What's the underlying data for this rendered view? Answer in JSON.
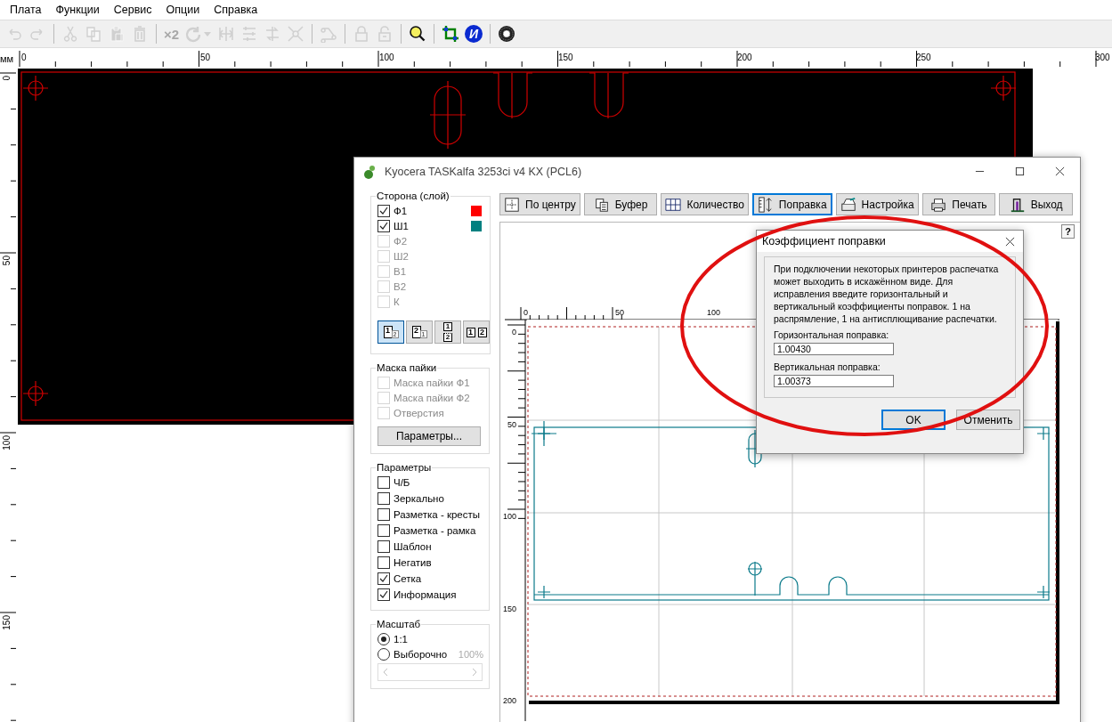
{
  "menu": [
    {
      "label": "Плата"
    },
    {
      "label": "Функции"
    },
    {
      "label": "Сервис"
    },
    {
      "label": "Опции"
    },
    {
      "label": "Справка"
    }
  ],
  "toolbar": [
    {
      "kind": "undo",
      "disabled": true
    },
    {
      "kind": "redo",
      "disabled": true
    },
    {
      "kind": "separator"
    },
    {
      "kind": "cut",
      "disabled": true
    },
    {
      "kind": "copy",
      "disabled": true
    },
    {
      "kind": "paste",
      "disabled": true
    },
    {
      "kind": "delete",
      "disabled": true
    },
    {
      "kind": "separator"
    },
    {
      "kind": "text",
      "label": "×2",
      "disabled": true
    },
    {
      "kind": "rotate",
      "disabled": true
    },
    {
      "kind": "caret",
      "disabled": true
    },
    {
      "kind": "mirror",
      "disabled": true
    },
    {
      "kind": "align",
      "disabled": true
    },
    {
      "kind": "flip",
      "disabled": true
    },
    {
      "kind": "shrink",
      "disabled": true
    },
    {
      "kind": "separator"
    },
    {
      "kind": "route",
      "disabled": true
    },
    {
      "kind": "separator"
    },
    {
      "kind": "lock",
      "disabled": true
    },
    {
      "kind": "unlock",
      "disabled": true
    },
    {
      "kind": "separator"
    },
    {
      "kind": "magnifier",
      "disabled": false
    },
    {
      "kind": "separator"
    },
    {
      "kind": "crop",
      "disabled": false
    },
    {
      "kind": "info",
      "label": "И",
      "disabled": false
    },
    {
      "kind": "separator"
    },
    {
      "kind": "pattern",
      "disabled": false
    }
  ],
  "ruler": {
    "unit": "мм",
    "x_labels": [
      "0",
      "50",
      "100",
      "150",
      "200",
      "250",
      "300"
    ],
    "y_labels": [
      "0",
      "50",
      "100",
      "150"
    ]
  },
  "print_window": {
    "title": "Kyocera TASKalfa 3253ci v4 KX (PCL6)",
    "side_group": {
      "title": "Сторона (слой)",
      "layers": [
        {
          "label": "Ф1",
          "checked": true,
          "disabled": false,
          "color": "#ff0000"
        },
        {
          "label": "Ш1",
          "checked": true,
          "disabled": false,
          "color": "#008080"
        },
        {
          "label": "Ф2",
          "checked": false,
          "disabled": true
        },
        {
          "label": "Ш2",
          "checked": false,
          "disabled": true
        },
        {
          "label": "В1",
          "checked": false,
          "disabled": true
        },
        {
          "label": "В2",
          "checked": false,
          "disabled": true
        },
        {
          "label": "К",
          "checked": false,
          "disabled": true
        }
      ],
      "layout_buttons": [
        {
          "kind": "overlap",
          "front": "1",
          "back": "2",
          "selected": true
        },
        {
          "kind": "overlap",
          "front": "2",
          "back": "1",
          "selected": false
        },
        {
          "kind": "stacked",
          "front": "1",
          "back": "2",
          "selected": false
        },
        {
          "kind": "side",
          "front": "1",
          "back": "2",
          "selected": false
        }
      ]
    },
    "mask_group": {
      "title": "Маска пайки",
      "items": [
        {
          "label": "Маска пайки Ф1",
          "checked": false,
          "disabled": true
        },
        {
          "label": "Маска пайки Ф2",
          "checked": false,
          "disabled": true
        },
        {
          "label": "Отверстия",
          "checked": false,
          "disabled": true
        }
      ],
      "button": "Параметры..."
    },
    "params_group": {
      "title": "Параметры",
      "items": [
        {
          "label": "Ч/Б",
          "checked": false,
          "disabled": false
        },
        {
          "label": "Зеркально",
          "checked": false,
          "disabled": false
        },
        {
          "label": "Разметка - кресты",
          "checked": false,
          "disabled": false
        },
        {
          "label": "Разметка - рамка",
          "checked": false,
          "disabled": false
        },
        {
          "label": "Шаблон",
          "checked": false,
          "disabled": false
        },
        {
          "label": "Негатив",
          "checked": false,
          "disabled": false
        },
        {
          "label": "Сетка",
          "checked": true,
          "disabled": false
        },
        {
          "label": "Информация",
          "checked": true,
          "disabled": false
        }
      ]
    },
    "scale_group": {
      "title": "Масштаб",
      "options": [
        {
          "label": "1:1",
          "selected": true
        },
        {
          "label": "Выборочно",
          "selected": false
        }
      ],
      "percent": "100%",
      "slider_disabled": true
    },
    "buttons": [
      {
        "kind": "center",
        "label": "По центру",
        "selected": false
      },
      {
        "kind": "clipboard",
        "label": "Буфер",
        "selected": false
      },
      {
        "kind": "count",
        "label": "Количество",
        "selected": false
      },
      {
        "kind": "correction",
        "label": "Поправка",
        "selected": true
      },
      {
        "kind": "setup",
        "label": "Настройка",
        "selected": false
      },
      {
        "kind": "print",
        "label": "Печать",
        "selected": false
      },
      {
        "kind": "exit",
        "label": "Выход",
        "selected": false
      }
    ],
    "help": "?",
    "preview": {
      "x_labels": [
        "0",
        "50",
        "100"
      ],
      "y_labels": [
        "0",
        "50",
        "100",
        "150",
        "200"
      ]
    }
  },
  "correction_dialog": {
    "title": "Коэффициент поправки",
    "description": "При подключении некоторых принтеров распечатка может выходить в искажённом виде. Для исправления введите горизонтальный и вертикальный коэффициенты поправок. 1 на распрямление, 1 на антисплющивание распечатки.",
    "horizontal": {
      "label": "Горизонтальная поправка:",
      "value": "1.00430"
    },
    "vertical": {
      "label": "Вертикальная поправка:",
      "value": "1.00373"
    },
    "ok": "OK",
    "cancel": "Отменить"
  }
}
